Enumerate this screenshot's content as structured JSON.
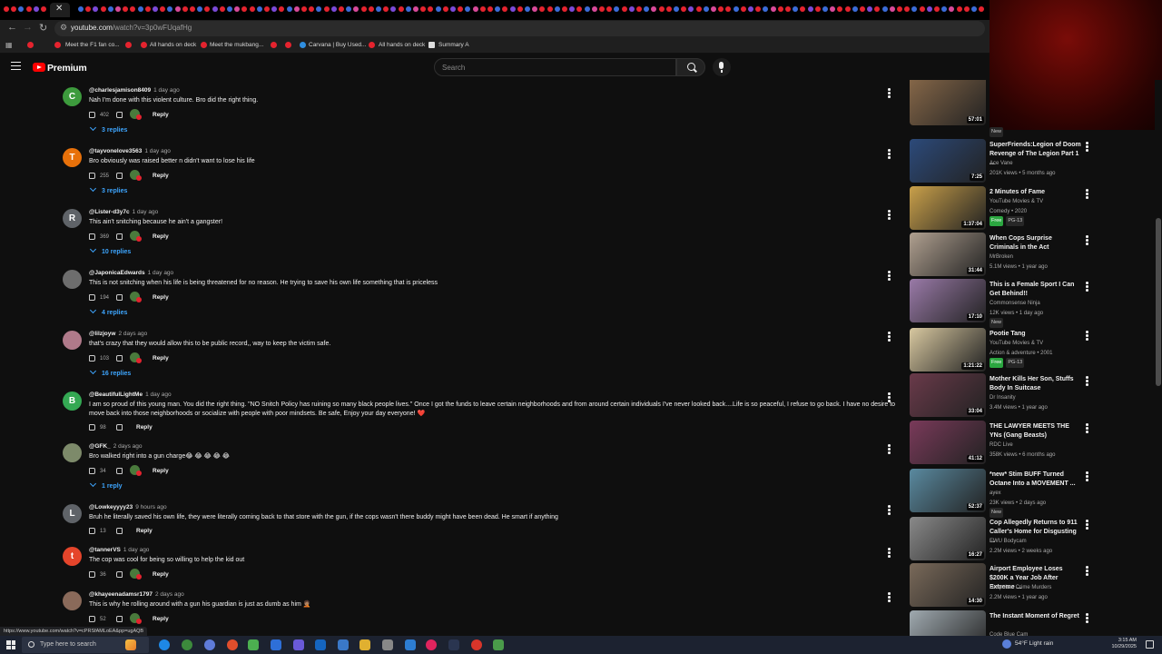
{
  "browser": {
    "url_host": "youtube.com",
    "url_path": "/watch?v=3p0wFUqafHg",
    "bookmarks": [
      "Meet the F1 fan co...",
      "All hands on deck",
      "Meet the mukbang...",
      "Carvana | Buy Used...",
      "All hands on deck",
      "Summary A"
    ],
    "status_url": "https://www.youtube.com/watch?v=cPRSfAMLoEA&pp=ugAQB"
  },
  "header": {
    "brand": "Premium",
    "search_placeholder": "Search"
  },
  "comments": [
    {
      "initial": "C",
      "avatar_color": "#3d9b3d",
      "handle": "@charlesjamison8409",
      "time": "1 day ago",
      "text": "Nah I'm done with this violent culture. Bro did the right thing.",
      "likes": "402",
      "creator_heart": true,
      "replies": "3 replies"
    },
    {
      "initial": "T",
      "avatar_color": "#e8710a",
      "handle": "@tayvonelove3563",
      "time": "1 day ago",
      "text": "Bro obviously was raised better n didn't want to lose his life",
      "likes": "255",
      "creator_heart": true,
      "replies": "3 replies"
    },
    {
      "initial": "R",
      "avatar_color": "#5f6368",
      "handle": "@Lister-d3y7c",
      "time": "1 day ago",
      "text": "This ain't snitching because he ain't a gangster!",
      "likes": "369",
      "creator_heart": true,
      "replies": "10 replies"
    },
    {
      "initial": "",
      "avatar_color": "#6d6d6d",
      "handle": "@JaponicaEdwards",
      "time": "1 day ago",
      "text": "This is not snitching when his life is being threatened for no reason. He trying to save his own life something that is priceless",
      "likes": "194",
      "creator_heart": true,
      "replies": "4 replies"
    },
    {
      "initial": "",
      "avatar_color": "#b07a8a",
      "handle": "@lilzjoyw",
      "time": "2 days ago",
      "text": "that's crazy that they would allow this to be public record,, way to keep the victim safe.",
      "likes": "103",
      "creator_heart": true,
      "replies": "16 replies"
    },
    {
      "initial": "B",
      "avatar_color": "#34a853",
      "handle": "@BeautifulLightMe",
      "time": "1 day ago",
      "text": "I am so proud of this young man. You did the right thing. \"NO Snitch Policy has ruining so many black people lives.\"  Once I got the funds to leave certain neighborhoods and from around certain individuals I've never looked back....Life is so peaceful, I refuse to go back. I have no desire to move back into those neighborhoods or socialize with people with poor mindsets. Be safe, Enjoy your day everyone! ❤️",
      "likes": "98",
      "creator_heart": false,
      "replies": ""
    },
    {
      "initial": "",
      "avatar_color": "#7d8a6a",
      "handle": "@GFK_",
      "time": "2 days ago",
      "text": "Bro walked right into a gun charge😂 😂 😂 😂 😂",
      "likes": "34",
      "creator_heart": true,
      "replies": "1 reply"
    },
    {
      "initial": "L",
      "avatar_color": "#5f6368",
      "handle": "@Lowkeyyyy23",
      "time": "9 hours ago",
      "text": "Bruh he literally saved his own life, they were literally coming back to that store with the gun, if the cops wasn't there buddy might have been dead. He smart if anything",
      "likes": "13",
      "creator_heart": false,
      "replies": ""
    },
    {
      "initial": "t",
      "avatar_color": "#e5452b",
      "handle": "@tannerVS",
      "time": "1 day ago",
      "text": "The cop was cool for being so willing to help the kid out",
      "likes": "36",
      "creator_heart": true,
      "replies": ""
    },
    {
      "initial": "",
      "avatar_color": "#8a6a5a",
      "handle": "@khayeenadamsr1797",
      "time": "2 days ago",
      "text": "This is why he rolling around with a gun his guardian is just as dumb as him 🤦🏽",
      "likes": "52",
      "creator_heart": true,
      "replies": ""
    }
  ],
  "reply_label": "Reply",
  "sidebar": [
    {
      "title": "",
      "channel": "",
      "meta": "",
      "duration": "57:01",
      "badge": "New",
      "free": "",
      "rating": "",
      "thumb": "#8a6a4a"
    },
    {
      "title": "SuperFriends:Legion of Doom Revenge of The Legion Part 1 ...",
      "channel": "Ace Vane",
      "meta": "201K views • 5 months ago",
      "duration": "7:25",
      "badge": "",
      "free": "",
      "rating": "",
      "thumb": "#2c4a7a"
    },
    {
      "title": "2 Minutes of Fame",
      "channel": "YouTube Movies & TV",
      "meta": "Comedy • 2020",
      "duration": "1:37:04",
      "badge": "",
      "free": "Free",
      "rating": "PG-13",
      "thumb": "#c9a04a"
    },
    {
      "title": "When Cops Surprise Criminals in the Act",
      "channel": "MrBroken",
      "meta": "5.1M views • 1 year ago",
      "duration": "31:44",
      "badge": "",
      "free": "",
      "rating": "",
      "thumb": "#b0a090"
    },
    {
      "title": "This is a Female Sport I Can Get Behind!!",
      "channel": "Commonsense Ninja",
      "meta": "12K views • 1 day ago",
      "duration": "17:10",
      "badge": "New",
      "free": "",
      "rating": "",
      "thumb": "#9a7aa8"
    },
    {
      "title": "Pootie Tang",
      "channel": "YouTube Movies & TV",
      "meta": "Action & adventure • 2001",
      "duration": "1:21:22",
      "badge": "",
      "free": "Free",
      "rating": "PG-13",
      "thumb": "#d8c8a0"
    },
    {
      "title": "Mother Kills Her Son, Stuffs Body In Suitcase",
      "channel": "Dr Insanity",
      "meta": "3.4M views • 1 year ago",
      "duration": "33:04",
      "badge": "",
      "free": "",
      "rating": "",
      "thumb": "#6a3a4a"
    },
    {
      "title": "THE LAWYER MEETS THE YNs (Gang Beasts)",
      "channel": "RDC Live",
      "meta": "358K views • 6 months ago",
      "duration": "41:12",
      "badge": "",
      "free": "",
      "rating": "",
      "thumb": "#7a3a5a"
    },
    {
      "title": "*new* Stim BUFF Turned Octane Into a MOVEMENT ...",
      "channel": "ayex",
      "meta": "23K views • 2 days ago",
      "duration": "52:37",
      "badge": "New",
      "free": "",
      "rating": "",
      "thumb": "#5a8aa0"
    },
    {
      "title": "Cop Allegedly Returns to 911 Caller's Home for Disgusting ...",
      "channel": "EWU Bodycam",
      "meta": "2.2M views • 2 weeks ago",
      "duration": "16:27",
      "badge": "",
      "free": "",
      "rating": "",
      "thumb": "#8a8a8a"
    },
    {
      "title": "Airport Employee Loses $200K a Year Job After Extreme ...",
      "channel": "Unspoken Crime Murders",
      "meta": "2.2M views • 1 year ago",
      "duration": "14:30",
      "badge": "",
      "free": "",
      "rating": "",
      "thumb": "#7a6a5a"
    },
    {
      "title": "The Instant Moment of Regret",
      "channel": "Code Blue Cam",
      "meta": "",
      "duration": "",
      "badge": "",
      "free": "",
      "rating": "",
      "thumb": "#a0aab0"
    }
  ],
  "taskbar": {
    "search_placeholder": "Type here to search",
    "weather": "54°F  Light rain",
    "time": "3:15 AM",
    "date": "10/29/2025"
  }
}
